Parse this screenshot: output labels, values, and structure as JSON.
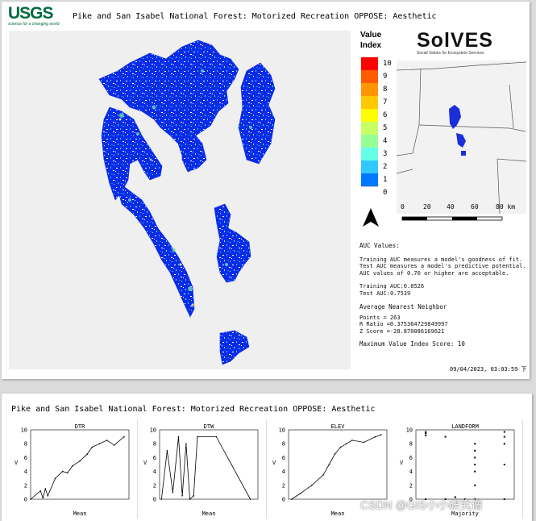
{
  "map_panel": {
    "logo_text": "USGS",
    "logo_tagline": "science for a changing world",
    "title": "Pike and San Isabel National Forest: Motorized Recreation OPPOSE: Aesthetic",
    "legend_title_line1": "Value",
    "legend_title_line2": "Index",
    "legend_labels": [
      "10",
      "9",
      "8",
      "7",
      "6",
      "5",
      "4",
      "3",
      "2",
      "1",
      "0"
    ],
    "legend_colors": [
      "#ff0000",
      "#ff5a00",
      "#ff9600",
      "#ffc800",
      "#ffff00",
      "#c8ff64",
      "#96ff96",
      "#64ffe6",
      "#32c8ff",
      "#0078ff",
      "#0000e6",
      "#ffffff"
    ],
    "solves_logo": "SolVES",
    "solves_sub": "Social Values for Ecosystem Services",
    "scale_labels": [
      "0",
      "20",
      "40",
      "60",
      "80 km"
    ],
    "auc_heading": "AUC Values:",
    "auc_desc1": "Training AUC measures a model's goodness of fit.",
    "auc_desc2": "Test AUC measures a model's predictive potential.",
    "auc_desc3": "AUC values of 0.70 or higher are acceptable.",
    "training_auc_label": "Training AUC:",
    "training_auc": "0.8526",
    "test_auc_label": "Test AUC:",
    "test_auc": "0.7539",
    "ann_heading": "Average Nearest Neighbor",
    "points": "Points = 263",
    "r_ratio": "R Ratio =0.375364729849997",
    "z_score": "Z Score =-28.870086169621",
    "max_score": "Maximum Value Index Score: 10",
    "timestamp": "09/04/2023, 03:03:59 下"
  },
  "response_panel": {
    "title": "Pike and San Isabel National Forest: Motorized Recreation OPPOSE: Aesthetic"
  },
  "chart_data": [
    {
      "type": "line",
      "title": "DTR",
      "xlabel": "Mean",
      "ylabel": "V",
      "xlim": [
        500,
        4500
      ],
      "ylim": [
        0,
        10
      ],
      "x": [
        500,
        900,
        1000,
        1100,
        1200,
        1500,
        1800,
        2000,
        2200,
        2500,
        2800,
        3000,
        3300,
        3600,
        3900,
        4300
      ],
      "y": [
        0,
        1.2,
        0.2,
        1.5,
        0.5,
        3,
        4,
        3.8,
        4.8,
        5.5,
        6.5,
        7.5,
        8,
        8.5,
        7.8,
        9
      ]
    },
    {
      "type": "line",
      "title": "DTW",
      "xlabel": "Mean",
      "ylabel": "V",
      "xlim": [
        0,
        2600
      ],
      "ylim": [
        0,
        10
      ],
      "x": [
        50,
        200,
        350,
        500,
        600,
        700,
        800,
        900,
        1000,
        1500,
        2400
      ],
      "y": [
        0,
        7,
        1,
        9,
        0.5,
        8,
        0,
        0.5,
        9,
        9,
        0
      ]
    },
    {
      "type": "line",
      "title": "ELEV",
      "xlabel": "Mean",
      "ylabel": "V",
      "xlim": [
        2500,
        4200
      ],
      "ylim": [
        0,
        10
      ],
      "x": [
        2550,
        2700,
        2900,
        3100,
        3200,
        3300,
        3400,
        3500,
        3600,
        3800,
        4000,
        4100
      ],
      "y": [
        0,
        0.8,
        2,
        3.5,
        5,
        6.5,
        7.5,
        8,
        8.5,
        8.2,
        9,
        9.3
      ]
    },
    {
      "type": "scatter",
      "title": "LANDFORM",
      "xlabel": "Majority",
      "ylabel": "V",
      "xlim": [
        0,
        10
      ],
      "ylim": [
        0,
        10
      ],
      "x": [
        1,
        1,
        1,
        1,
        3,
        3,
        4,
        5,
        6,
        6,
        6,
        6,
        6,
        6,
        6,
        9,
        9,
        9,
        9,
        9
      ],
      "y": [
        0,
        9.5,
        9.2,
        9.7,
        0,
        9,
        0.3,
        0,
        0,
        2,
        4,
        5,
        6,
        7,
        8,
        0,
        5,
        8,
        9,
        9.7
      ]
    }
  ],
  "watermark": "CSDN @GIS小小研究僧"
}
